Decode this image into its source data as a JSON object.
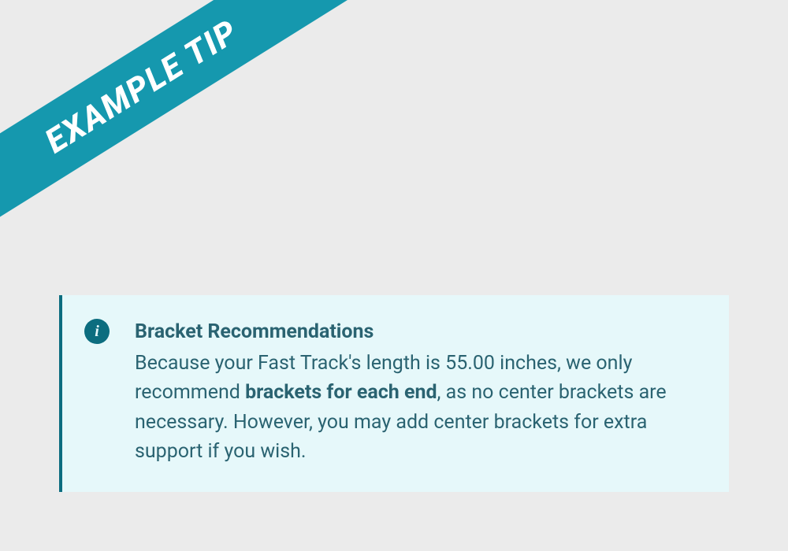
{
  "ribbon": {
    "label": "EXAMPLE TIP"
  },
  "info": {
    "icon_name": "info-icon",
    "title": "Bracket Recommendations",
    "body_prefix": "Because your Fast Track's length is 55.00 inches, we only recommend ",
    "body_bold": "brackets for each end",
    "body_suffix": ", as no center brackets are necessary. However, you may add center brackets for extra support if you wish."
  },
  "colors": {
    "ribbon_bg": "#1598ae",
    "card_bg": "#e6f8fa",
    "accent": "#0c6d7f",
    "text": "#2a6371",
    "page_bg": "#ebebeb"
  }
}
